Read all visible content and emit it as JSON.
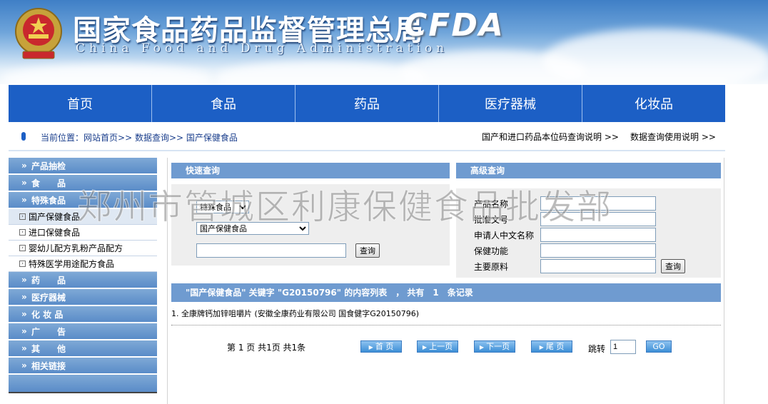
{
  "header": {
    "title_cn": "国家食品药品监督管理总局",
    "title_en": "China Food and Drug Administration",
    "logo_text": "CFDA",
    "emblem_icon": "national-emblem-icon"
  },
  "nav": {
    "items": [
      "首页",
      "食品",
      "药品",
      "医疗器械",
      "化妆品"
    ]
  },
  "breadcrumb": {
    "prefix": "当前位置：",
    "home": "网站首页",
    "sep1": ">>",
    "level2": "数据查询",
    "sep2": ">>",
    "level3": "国产保健食品",
    "link1": "国产和进口药品本位码查询说明 >>",
    "link2": "数据查询使用说明 >>"
  },
  "sidebar": {
    "sections": {
      "s1": "产品抽检",
      "s2": "食　　品",
      "s3": "特殊食品",
      "s4": "药　　品",
      "s5": "医疗器械",
      "s6": "化 妆 品",
      "s7": "广　　告",
      "s8": "其　　他",
      "s9": "相关链接"
    },
    "sub": [
      "国产保健食品",
      "进口保健食品",
      "婴幼儿配方乳粉产品配方",
      "特殊医学用途配方食品"
    ]
  },
  "quick_search": {
    "title": "快速查询",
    "category_select": "特殊食品",
    "type_select": "国产保健食品",
    "keyword_value": "",
    "button": "查询"
  },
  "advanced_search": {
    "title": "高级查询",
    "labels": [
      "产品名称",
      "批准文号",
      "申请人中文名称",
      "保健功能",
      "主要原料"
    ],
    "button": "查询"
  },
  "results": {
    "header": "\"国产保健食品\" 关键字 \"G20150796\" 的内容列表　， 共有　1　条记录",
    "rows": [
      "1. 全康牌钙加锌咀嚼片 (安徽全康药业有限公司 国食健字G20150796)"
    ]
  },
  "pager": {
    "info": "第 1 页  共1页  共1条",
    "first": "首 页",
    "prev": "上一页",
    "next": "下一页",
    "last": "尾 页",
    "jump_label": "跳转",
    "jump_value": "1",
    "go": "GO"
  },
  "watermark": "郑州市管城区利康保健食品批发部"
}
